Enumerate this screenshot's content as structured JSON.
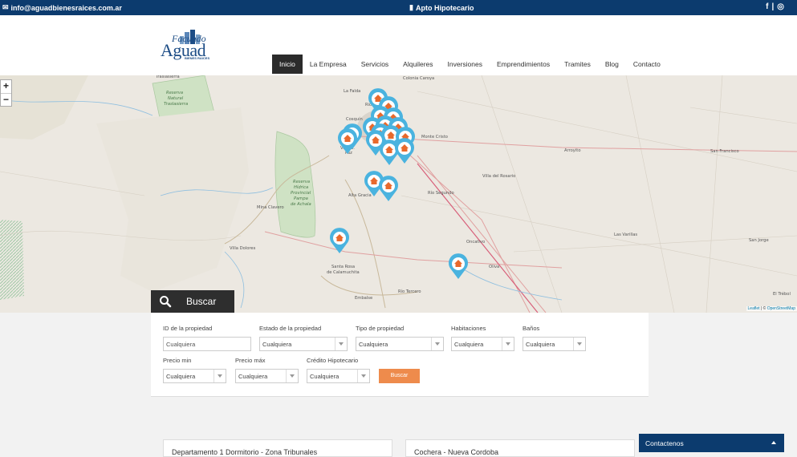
{
  "topbar": {
    "email": "info@aguadbienesraices.com.ar",
    "apto": "Apto Hipotecario",
    "social": [
      "f",
      "|",
      "◎"
    ]
  },
  "logo": {
    "line1": "Facundo",
    "line2": "Aguad",
    "line3": "BIENES RAICES"
  },
  "nav": [
    "Inicio",
    "La Empresa",
    "Servicios",
    "Alquileres",
    "Inversiones",
    "Emprendimientos",
    "Tramites",
    "Blog",
    "Contacto"
  ],
  "map": {
    "zoom_in": "+",
    "zoom_out": "−",
    "attribution_a": "Leaflet",
    "attribution_b": " | © ",
    "attribution_c": "OpenStreetMap",
    "places": [
      "Traslasierra",
      "Reserva",
      "Natural",
      "Traslasierra",
      "La Falda",
      "Colonia Caroya",
      "Rio",
      "Cosquín",
      "Villa C.",
      "Paz",
      "Monte Cristo",
      "Arroyito",
      "San Francisco",
      "Villa del Rosario",
      "Reserva",
      "Hídrica",
      "Provincial",
      "Pampa",
      "de Achala",
      "Alta Gracia",
      "Río Segundo",
      "Mina Clavero",
      "Las Varillas",
      "San Jorge",
      "Oncativo",
      "Villa Dolores",
      "Oliva",
      "Santa Rosa",
      "de Calamuchita",
      "El Trébol",
      "Embalse",
      "Río Tercero"
    ]
  },
  "search": {
    "tab_label": "Buscar",
    "fields": {
      "id_label": "ID de la propiedad",
      "id_placeholder": "Cualquiera",
      "estado_label": "Estado de la propiedad",
      "estado_value": "Cualquiera",
      "tipo_label": "Tipo de propiedad",
      "tipo_value": "Cualquiera",
      "hab_label": "Habitaciones",
      "hab_value": "Cualquiera",
      "banos_label": "Baños",
      "banos_value": "Cualquiera",
      "pmin_label": "Precio min",
      "pmin_value": "Cualquiera",
      "pmax_label": "Precio máx",
      "pmax_value": "Cualquiera",
      "credito_label": "Crédito Hipotecario",
      "credito_value": "Cualquiera"
    },
    "button": "Buscar"
  },
  "cards": [
    "Departamento 1 Dormitorio - Zona Tribunales",
    "Cochera - Nueva Cordoba"
  ],
  "contact_widget": "Contactenos",
  "colors": {
    "topbar": "#0c3b6e",
    "marker": "#4ab3df",
    "accent": "#ee8b4c"
  }
}
